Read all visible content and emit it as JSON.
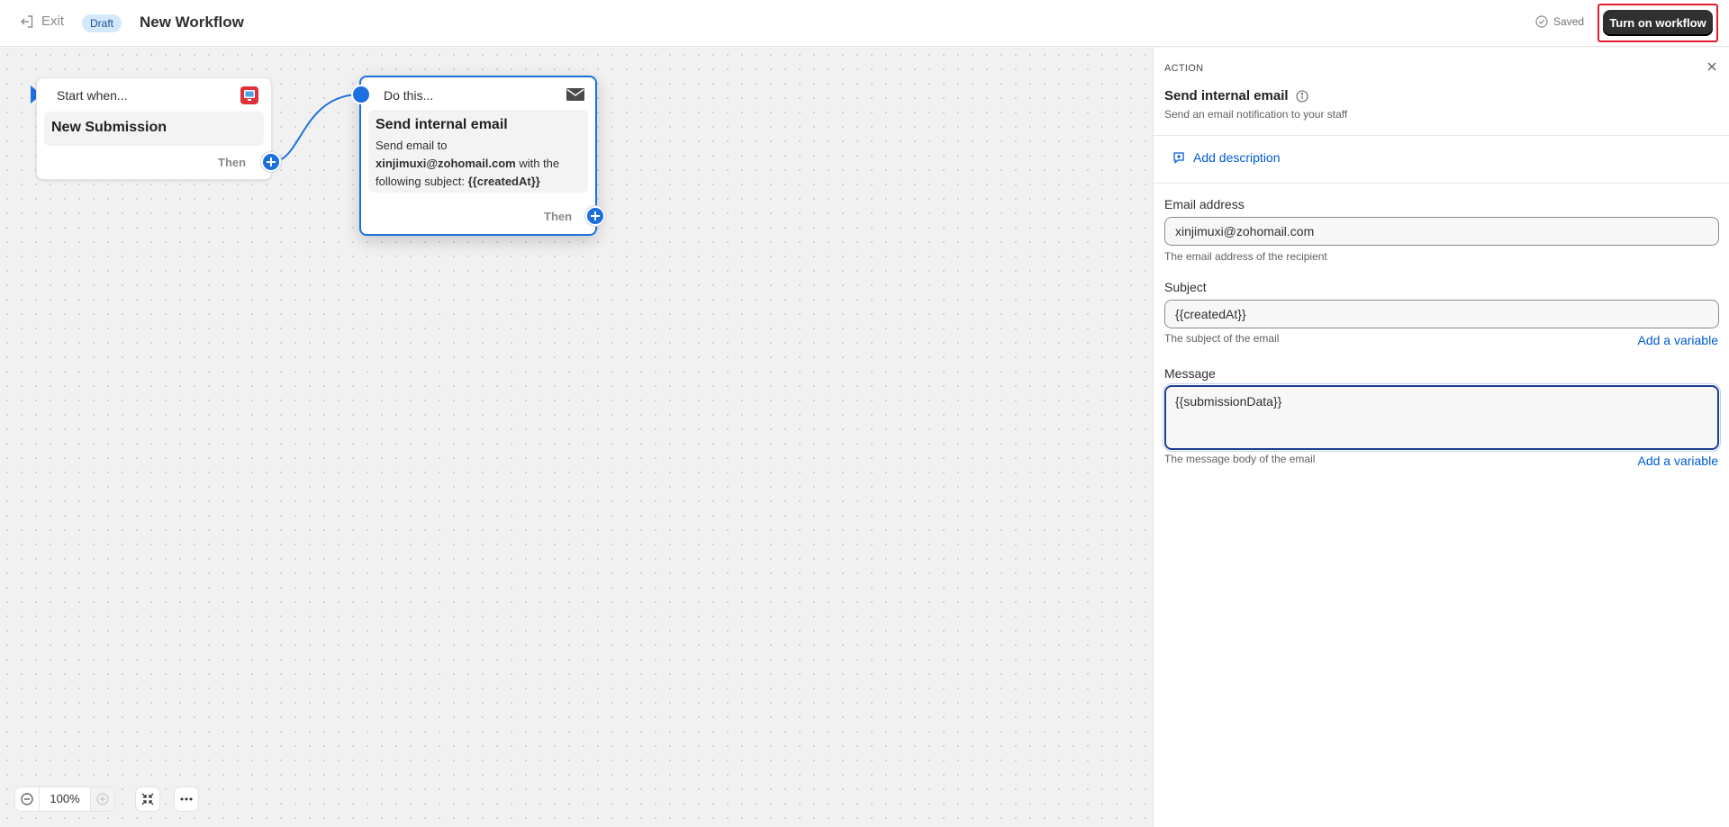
{
  "header": {
    "exit_label": "Exit",
    "status_badge": "Draft",
    "title": "New Workflow",
    "saved_label": "Saved",
    "turn_on_label": "Turn on workflow"
  },
  "canvas": {
    "trigger_node": {
      "heading": "Start when...",
      "title": "New Submission",
      "then_label": "Then",
      "icon": "monitor-icon"
    },
    "action_node": {
      "heading": "Do this...",
      "title": "Send internal email",
      "desc_prefix": "Send email to",
      "desc_email": "xinjimuxi@zohomail.com",
      "desc_middle": "with the following subject:",
      "desc_subject": "{{createdAt}}",
      "then_label": "Then",
      "icon": "mail-icon"
    },
    "zoom": {
      "value": "100%"
    }
  },
  "panel": {
    "kicker": "ACTION",
    "title": "Send internal email",
    "subtitle": "Send an email notification to your staff",
    "add_description": "Add description",
    "email": {
      "label": "Email address",
      "value": "xinjimuxi@zohomail.com",
      "help": "The email address of the recipient"
    },
    "subject": {
      "label": "Subject",
      "value": "{{createdAt}}",
      "help": "The subject of the email",
      "add_variable": "Add a variable"
    },
    "message": {
      "label": "Message",
      "value": "{{submissionData}}",
      "help": "The message body of the email",
      "add_variable": "Add a variable"
    }
  },
  "colors": {
    "accent": "#1d6fe0",
    "link": "#005bd3",
    "primary_button": "#303030",
    "draft_badge_bg": "#d4e8fb",
    "highlight_border": "#e11c2e"
  }
}
